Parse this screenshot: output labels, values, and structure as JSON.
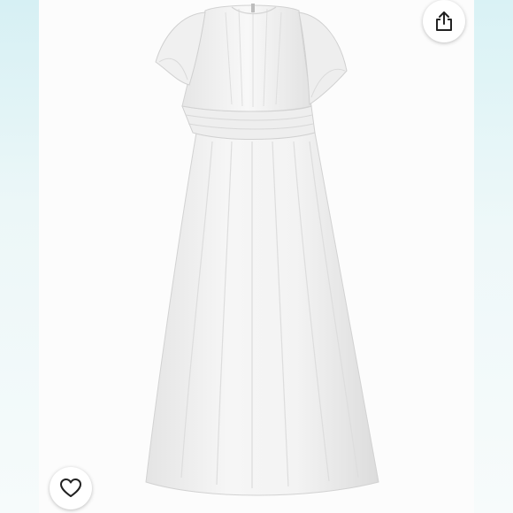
{
  "product_image": {
    "subject": "white-chiffon-flutter-sleeve-dress",
    "background_color": "#fcfcfc",
    "dress_color": "#f1f1f1"
  },
  "actions": {
    "share_icon": "share-icon",
    "like_icon": "heart-outline-icon"
  },
  "colors": {
    "left_edge": "#d6f0f4",
    "right_edge": "#d9f2f5",
    "icon_stroke": "#222222"
  }
}
